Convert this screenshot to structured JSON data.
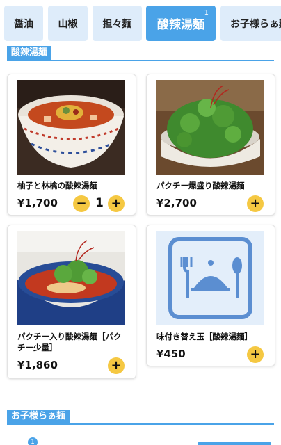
{
  "tabs": [
    {
      "label": "醤油"
    },
    {
      "label": "山椒"
    },
    {
      "label": "担々麺"
    },
    {
      "label": "酸辣湯麺",
      "badge": "1",
      "active": true
    },
    {
      "label": "お子様らぁ麺"
    }
  ],
  "sections": [
    {
      "title": "酸辣湯麺"
    },
    {
      "title": "お子様らぁ麺"
    }
  ],
  "items": [
    {
      "name": "柚子と林檎の酸辣湯麺",
      "price": "¥1,700",
      "quantity": "1"
    },
    {
      "name": "パクチー爆盛り酸辣湯麺",
      "price": "¥2,700"
    },
    {
      "name": "パクチー入り酸辣湯麺［パクチー少量］",
      "price": "¥1,860"
    },
    {
      "name": "味付き替え玉［酸辣湯麺］",
      "price": "¥450"
    }
  ],
  "buttons": {
    "plus": "+",
    "minus": "−"
  },
  "cart": {
    "count": "1"
  },
  "colors": {
    "accent": "#4aa3e8",
    "button": "#f5c842",
    "tab_inactive": "#deecfa"
  }
}
